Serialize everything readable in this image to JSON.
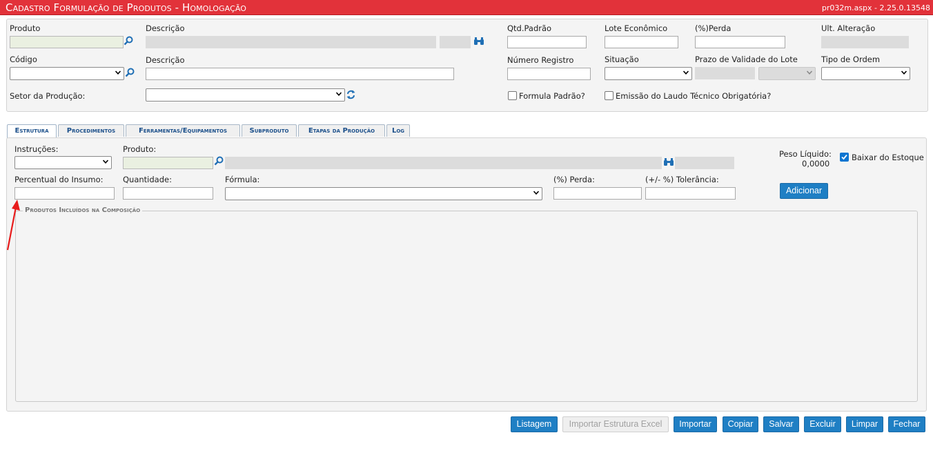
{
  "window": {
    "title": "Cadastro Formulação de Produtos  - Homologação",
    "version": "pr032m.aspx - 2.25.0.13548"
  },
  "header": {
    "produto_label": "Produto",
    "descricao1_label": "Descrição",
    "qtd_padrao_label": "Qtd.Padrão",
    "lote_economico_label": "Lote Econômico",
    "perda_label": "(%)Perda",
    "ult_alteracao_label": "Ult. Alteração",
    "codigo_label": "Código",
    "descricao2_label": "Descrição",
    "numero_registro_label": "Número Registro",
    "situacao_label": "Situação",
    "prazo_validade_label": "Prazo de Validade do Lote",
    "tipo_ordem_label": "Tipo de Ordem",
    "setor_producao_label": "Setor da Produção:",
    "formula_padrao_label": "Formula Padrão?",
    "emissao_laudo_label": "Emissão do Laudo Técnico Obrigatória?"
  },
  "tabs": [
    {
      "label": "Estrutura"
    },
    {
      "label": "Procedimentos"
    },
    {
      "label": "Ferramentas/Equipamentos"
    },
    {
      "label": "Subproduto"
    },
    {
      "label": "Etapas da Produção"
    },
    {
      "label": "Log"
    }
  ],
  "estrutura": {
    "instrucoes_label": "Instruções:",
    "produto_label": "Produto:",
    "peso_liquido_label": "Peso Líquido:",
    "peso_liquido_value": "0,0000",
    "baixar_estoque_label": "Baixar do Estoque",
    "baixar_estoque_checked": true,
    "percentual_insumo_label": "Percentual do Insumo:",
    "quantidade_label": "Quantidade:",
    "formula_label": "Fórmula:",
    "perda_label": "(%) Perda:",
    "tolerancia_label": "(+/- %) Tolerância:",
    "adicionar_label": "Adicionar",
    "fieldset_legend": "Produtos Incluídos na Composição"
  },
  "footer_buttons": [
    {
      "label": "Listagem",
      "enabled": true
    },
    {
      "label": "Importar Estrutura Excel",
      "enabled": false
    },
    {
      "label": "Importar",
      "enabled": true
    },
    {
      "label": "Copiar",
      "enabled": true
    },
    {
      "label": "Salvar",
      "enabled": true
    },
    {
      "label": "Excluir",
      "enabled": true
    },
    {
      "label": "Limpar",
      "enabled": true
    },
    {
      "label": "Fechar",
      "enabled": true
    }
  ],
  "colors": {
    "titlebar": "#e2323a",
    "button": "#1f7fc4",
    "annotation_arrow": "#e81c1c"
  }
}
